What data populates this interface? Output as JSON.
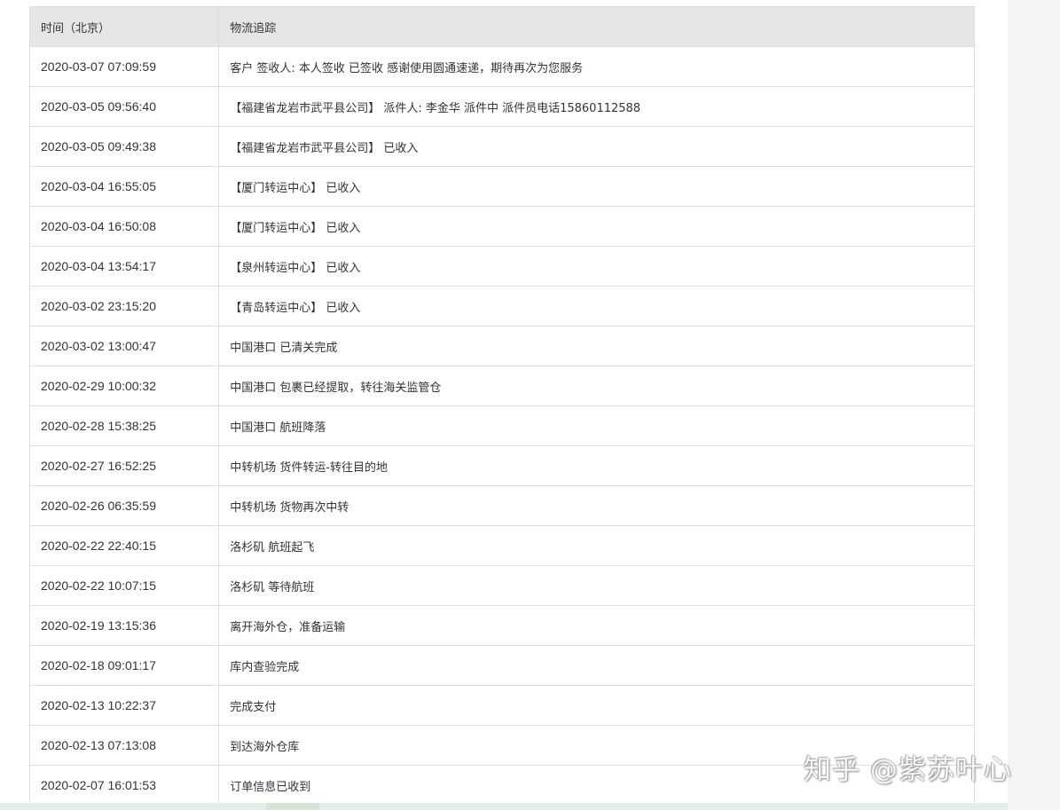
{
  "table": {
    "headers": {
      "time": "时间（北京）",
      "info": "物流追踪"
    },
    "rows": [
      {
        "time": "2020-03-07 07:09:59",
        "info": "客户 签收人: 本人签收 已签收 感谢使用圆通速递，期待再次为您服务"
      },
      {
        "time": "2020-03-05 09:56:40",
        "info": "【福建省龙岩市武平县公司】 派件人: 李金华 派件中 派件员电话15860112588"
      },
      {
        "time": "2020-03-05 09:49:38",
        "info": "【福建省龙岩市武平县公司】 已收入"
      },
      {
        "time": "2020-03-04 16:55:05",
        "info": "【厦门转运中心】 已收入"
      },
      {
        "time": "2020-03-04 16:50:08",
        "info": "【厦门转运中心】 已收入"
      },
      {
        "time": "2020-03-04 13:54:17",
        "info": "【泉州转运中心】 已收入"
      },
      {
        "time": "2020-03-02 23:15:20",
        "info": "【青岛转运中心】 已收入"
      },
      {
        "time": "2020-03-02 13:00:47",
        "info": "中国港口 已清关完成"
      },
      {
        "time": "2020-02-29 10:00:32",
        "info": "中国港口 包裹已经提取，转往海关监管仓"
      },
      {
        "time": "2020-02-28 15:38:25",
        "info": "中国港口 航班降落"
      },
      {
        "time": "2020-02-27 16:52:25",
        "info": "中转机场 货件转运-转往目的地"
      },
      {
        "time": "2020-02-26 06:35:59",
        "info": "中转机场 货物再次中转"
      },
      {
        "time": "2020-02-22 22:40:15",
        "info": "洛杉矶 航班起飞"
      },
      {
        "time": "2020-02-22 10:07:15",
        "info": "洛杉矶 等待航班"
      },
      {
        "time": "2020-02-19 13:15:36",
        "info": "离开海外仓，准备运输"
      },
      {
        "time": "2020-02-18 09:01:17",
        "info": "库内查验完成"
      },
      {
        "time": "2020-02-13 10:22:37",
        "info": "完成支付"
      },
      {
        "time": "2020-02-13 07:13:08",
        "info": "到达海外仓库"
      },
      {
        "time": "2020-02-07 16:01:53",
        "info": "订单信息已收到"
      }
    ]
  },
  "watermark": "知乎 @紫苏叶心",
  "colors": {
    "header_bg": "#e6e6e6",
    "border": "#dddddd",
    "text": "#333333",
    "right_strip": "#f4f4f4",
    "bottom_bar": "#e3efe6"
  }
}
